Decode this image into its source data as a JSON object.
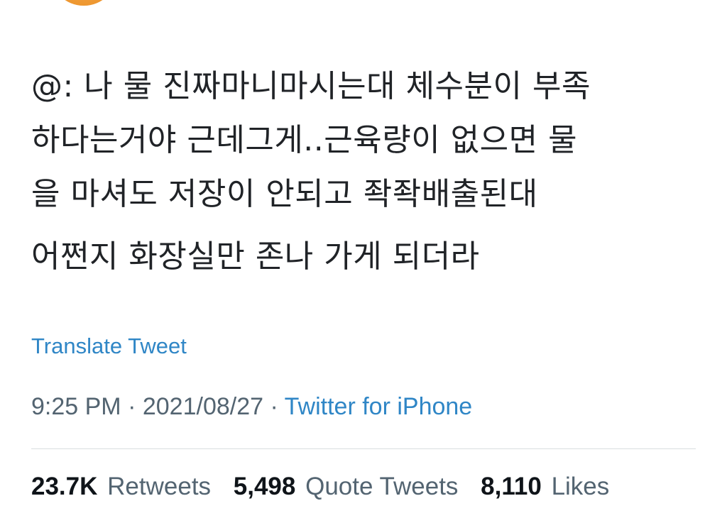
{
  "tweet": {
    "text_line1": "@: 나 물 진짜마니마시는대 체수분이 부족",
    "text_line2": "하다는거야 근데그게..근육량이 없으면 물",
    "text_line3": "을 마셔도 저장이 안되고 좍좍배출된대",
    "text_line4": "어쩐지 화장실만 존나 가게 되더라",
    "translate_label": "Translate Tweet",
    "time": "9:25 PM",
    "separator": "·",
    "date": "2021/08/27",
    "source": "Twitter for iPhone"
  },
  "stats": {
    "retweets_count": "23.7K",
    "retweets_label": "Retweets",
    "quotes_count": "5,498",
    "quotes_label": "Quote Tweets",
    "likes_count": "8,110",
    "likes_label": "Likes"
  },
  "colors": {
    "link": "#2f86c6",
    "muted": "#536471",
    "avatar": "#ee9730"
  }
}
